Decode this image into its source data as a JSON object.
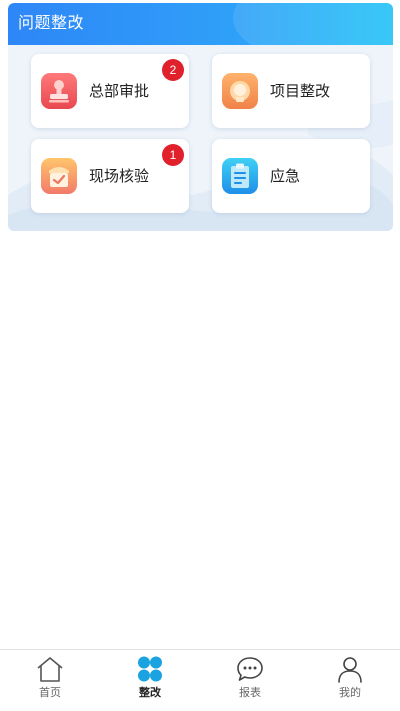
{
  "colors": {
    "header_start": "#2e86f7",
    "header_end": "#22c2f7",
    "badge": "#e0202a",
    "active_tab": "#1aa3e0"
  },
  "section": {
    "title": "问题整改"
  },
  "cards": [
    {
      "label": "总部审批",
      "icon": "stamp-icon",
      "badge": "2"
    },
    {
      "label": "项目整改",
      "icon": "lightbulb-icon",
      "badge": ""
    },
    {
      "label": "现场核验",
      "icon": "checklist-icon",
      "badge": "1"
    },
    {
      "label": "应急",
      "icon": "clipboard-icon",
      "badge": ""
    }
  ],
  "tabbar": {
    "items": [
      {
        "label": "首页",
        "icon": "home-icon",
        "active": false
      },
      {
        "label": "整改",
        "icon": "grid-icon",
        "active": true
      },
      {
        "label": "报表",
        "icon": "chat-icon",
        "active": false
      },
      {
        "label": "我的",
        "icon": "user-icon",
        "active": false
      }
    ]
  }
}
